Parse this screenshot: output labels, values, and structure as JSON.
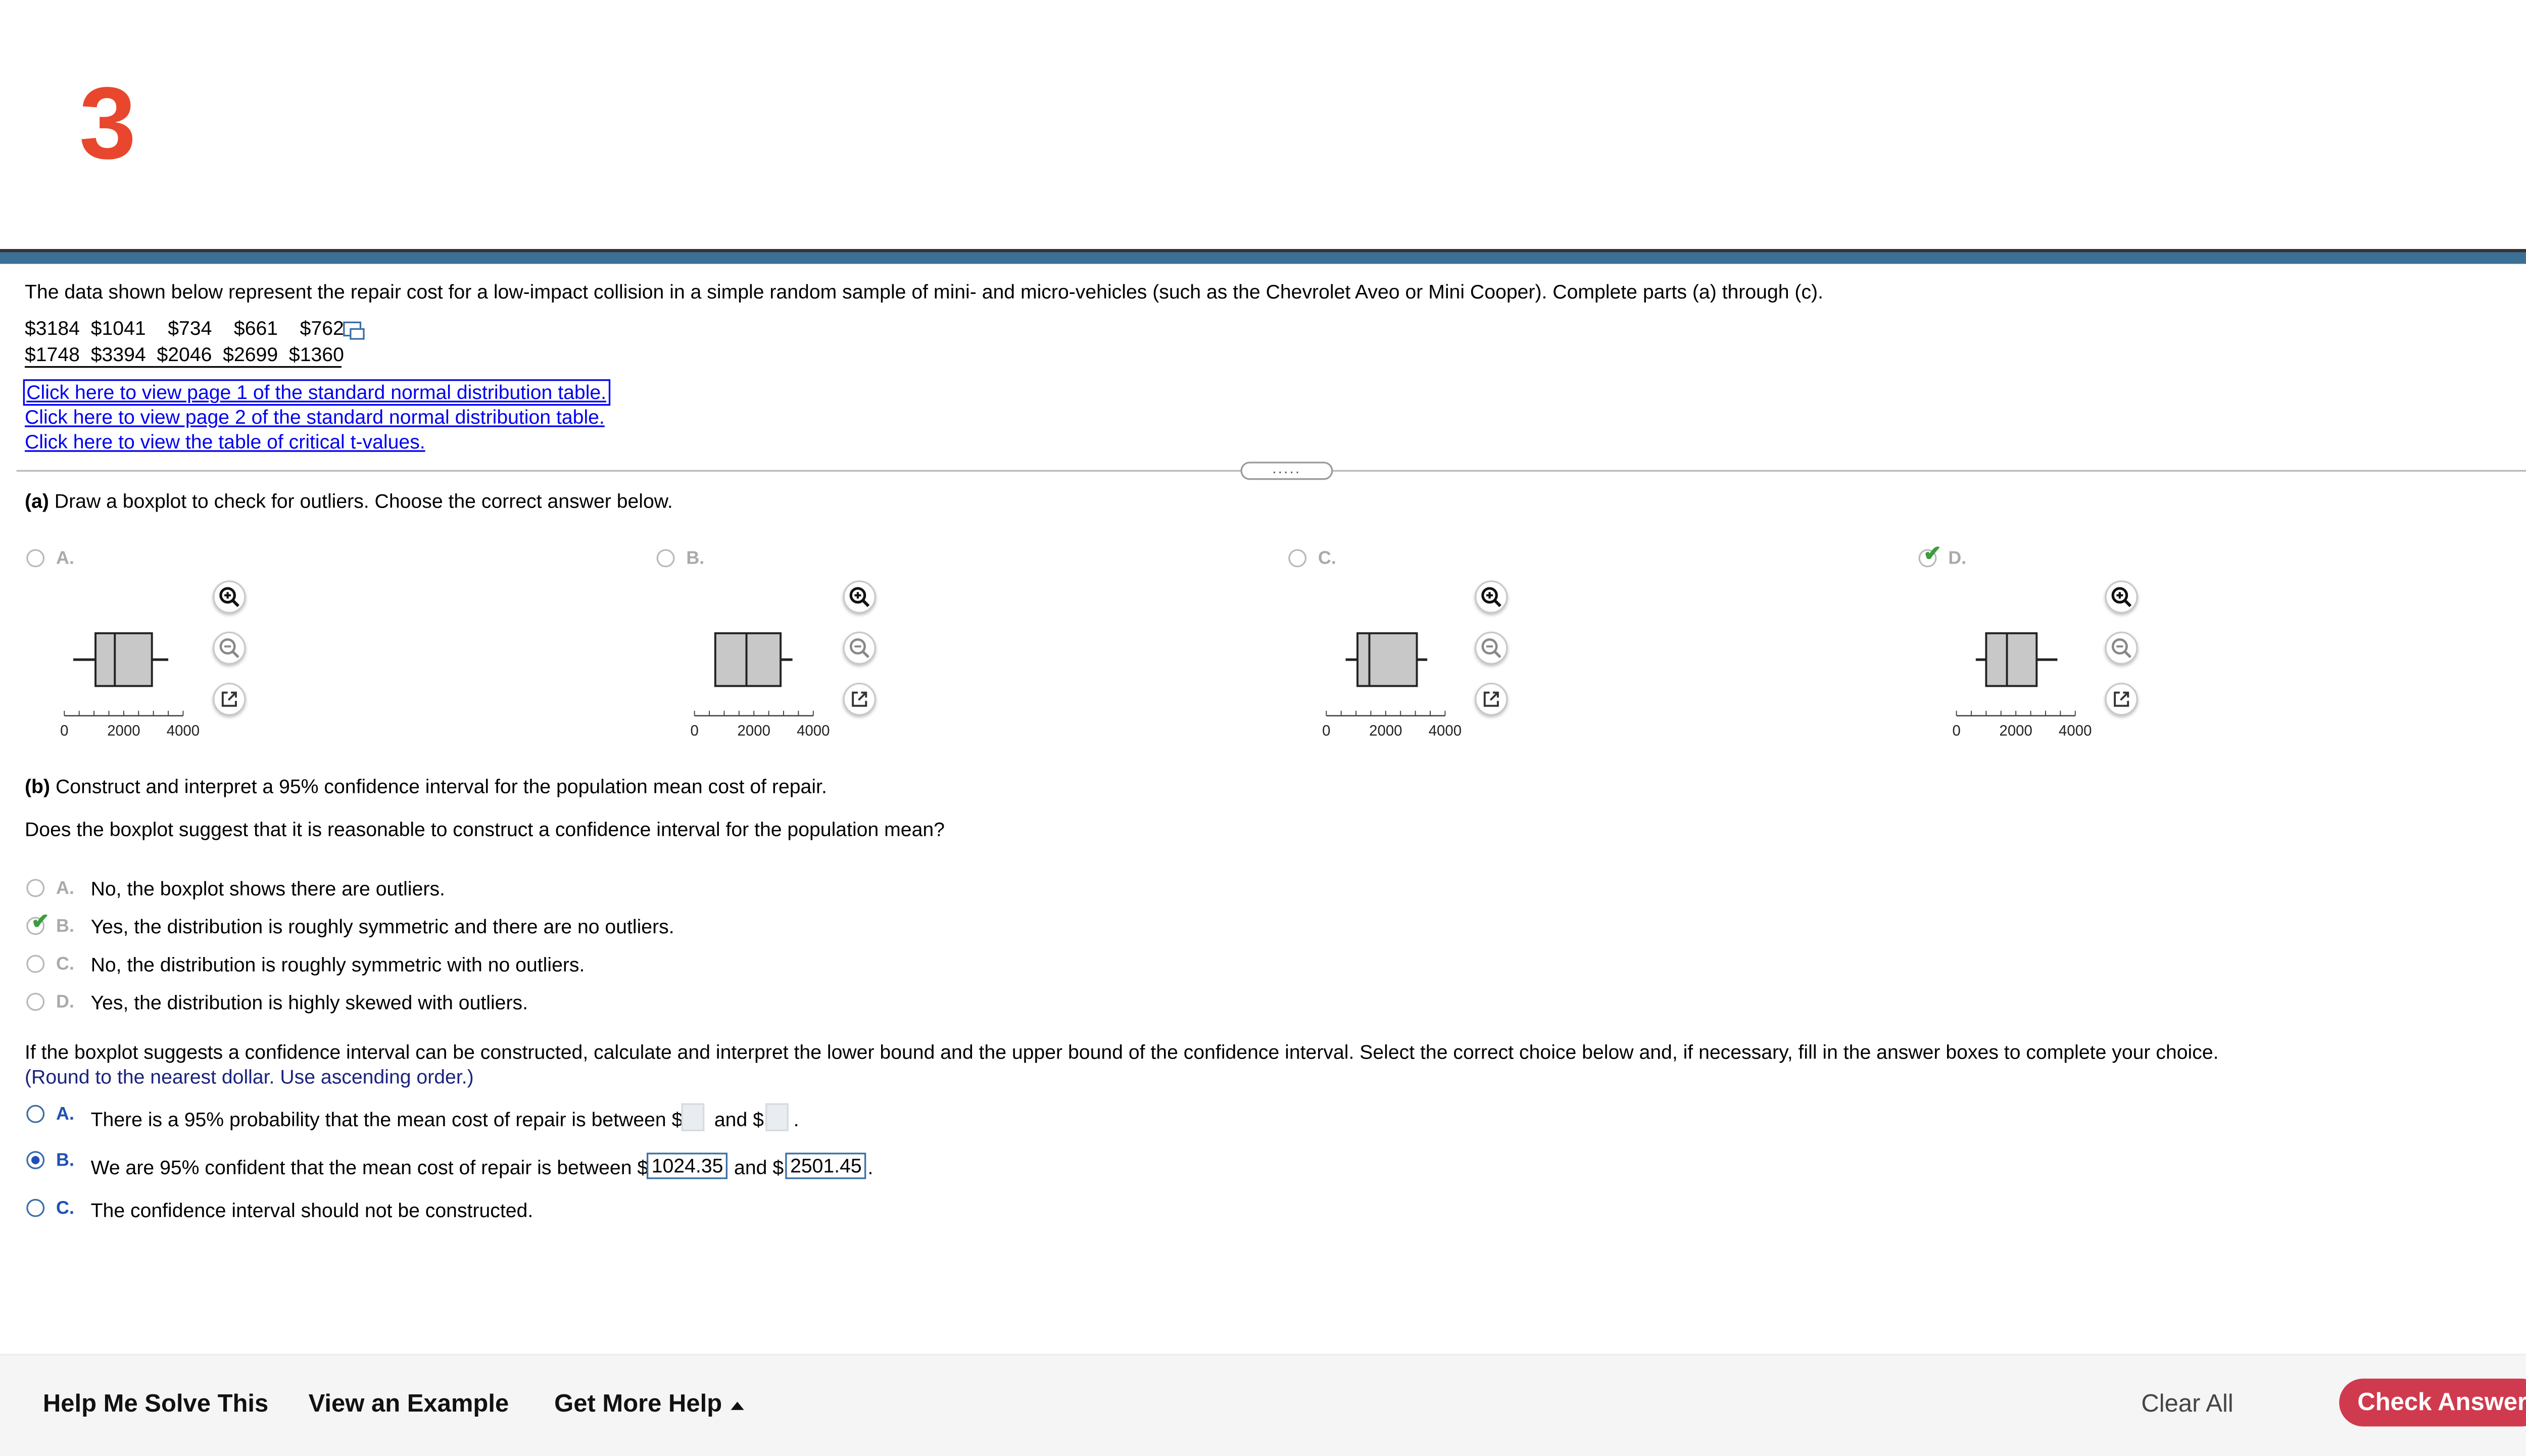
{
  "question": {
    "number": "3"
  },
  "problem": {
    "intro": "The data shown below represent the repair cost for a low-impact collision in a simple random sample of mini- and micro-vehicles (such as the Chevrolet Aveo or Mini Cooper). Complete parts (a) through (c).",
    "data_rows": [
      "$3184  $1041    $734    $661    $762",
      "$1748  $3394  $2046  $2699  $1360"
    ],
    "links": [
      "Click here to view page 1 of the standard normal distribution table.",
      "Click here to view page 2 of the standard normal distribution table.",
      "Click here to view the table of critical t-values."
    ],
    "divider_handle": "....."
  },
  "part_a": {
    "label": "(a)",
    "text": "Draw a boxplot to check for outliers. Choose the correct answer below.",
    "options": [
      {
        "letter": "A.",
        "min": 300,
        "q1": 1050,
        "median": 1700,
        "q3": 2950,
        "max": 3500,
        "selected": false
      },
      {
        "letter": "B.",
        "min": 700,
        "q1": 700,
        "median": 1750,
        "q3": 2900,
        "max": 3300,
        "selected": false
      },
      {
        "letter": "C.",
        "min": 650,
        "q1": 1050,
        "median": 1450,
        "q3": 3050,
        "max": 3400,
        "selected": false
      },
      {
        "letter": "D.",
        "min": 650,
        "q1": 1000,
        "median": 1700,
        "q3": 2700,
        "max": 3400,
        "selected": true
      }
    ],
    "axis": {
      "min": 0,
      "max": 4000,
      "tick_labels": [
        "0",
        "2000",
        "4000"
      ]
    }
  },
  "part_b": {
    "label": "(b)",
    "text": "Construct and interpret a 95% confidence interval for the population mean cost of repair.",
    "question": "Does the boxplot suggest that it is reasonable to construct a confidence interval for the population mean?",
    "options": [
      {
        "letter": "A.",
        "text": "No, the boxplot shows there are outliers."
      },
      {
        "letter": "B.",
        "text": "Yes, the distribution is roughly symmetric and there are no outliers."
      },
      {
        "letter": "C.",
        "text": "No, the distribution is roughly symmetric with no outliers."
      },
      {
        "letter": "D.",
        "text": "Yes, the distribution is highly skewed with outliers."
      }
    ],
    "instruction": "If the boxplot suggests a confidence interval can be constructed, calculate and interpret the lower bound and the upper bound of the confidence interval. Select the correct choice below and, if necessary, fill in the answer boxes to complete your choice.",
    "hint": "(Round to the nearest dollar. Use ascending order.)",
    "choices": {
      "a_letter": "A.",
      "a_text": "There is a 95% probability that the mean cost of repair is between $",
      "and_text": "and $",
      "period": ".",
      "b_letter": "B.",
      "b_text": "We are 95% confident that the mean cost of repair is between $",
      "lower": "1024.35",
      "upper": "2501.45",
      "c_letter": "C.",
      "c_text": "The confidence interval should not be constructed."
    }
  },
  "footer": {
    "help_me_solve": "Help Me Solve This",
    "view_example": "View an Example",
    "get_more_help": "Get More Help",
    "clear_all": "Clear All",
    "check_answer": "Check Answer"
  },
  "colors": {
    "accent_red": "#cf3a4e",
    "question_number": "#e8472d",
    "bar_blue": "#3a6f96",
    "check_green": "#3e9b3e",
    "radio_blue": "#1f50b3"
  }
}
